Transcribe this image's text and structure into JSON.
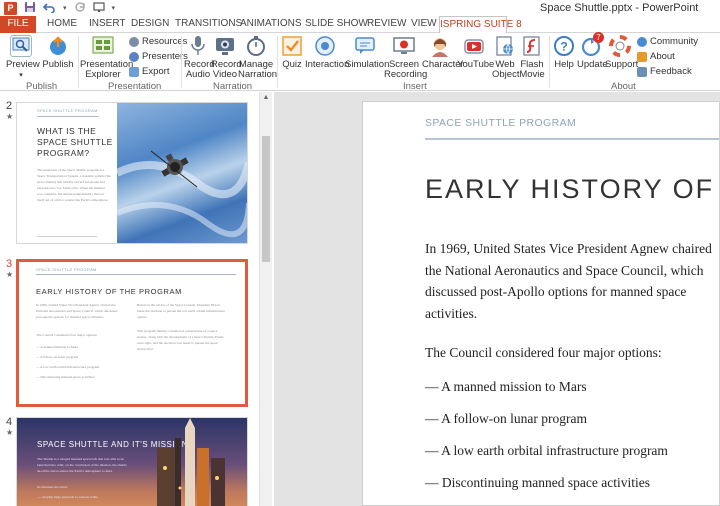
{
  "window": {
    "title": "Space Shuttle.pptx - PowerPoint",
    "app_logo": "P"
  },
  "qat": {
    "save_icon": "save-icon",
    "undo_icon": "undo-icon",
    "redo_icon": "redo-icon"
  },
  "tabs": [
    {
      "label": "FILE"
    },
    {
      "label": "HOME"
    },
    {
      "label": "INSERT"
    },
    {
      "label": "DESIGN"
    },
    {
      "label": "TRANSITIONS"
    },
    {
      "label": "ANIMATIONS"
    },
    {
      "label": "SLIDE SHOW"
    },
    {
      "label": "REVIEW"
    },
    {
      "label": "VIEW"
    },
    {
      "label": "ISPRING SUITE 8"
    }
  ],
  "ribbon": {
    "publish_group": {
      "label": "Publish",
      "preview": "Preview",
      "preview_arrow": "▾",
      "publish": "Publish"
    },
    "presentation_group": {
      "label": "Presentation",
      "explorer_line1": "Presentation",
      "explorer_line2": "Explorer",
      "resources": "Resources",
      "presenters": "Presenters",
      "export": "Export"
    },
    "narration_group": {
      "label": "Narration",
      "record_audio_1": "Record",
      "record_audio_2": "Audio",
      "record_video_1": "Record",
      "record_video_2": "Video",
      "manage_1": "Manage",
      "manage_2": "Narration"
    },
    "insert_group": {
      "label": "Insert",
      "quiz": "Quiz",
      "interaction": "Interaction",
      "simulation": "Simulation",
      "screen_1": "Screen",
      "screen_2": "Recording",
      "character": "Character",
      "youtube": "YouTube",
      "web_1": "Web",
      "web_2": "Object",
      "flash_1": "Flash",
      "flash_2": "Movie"
    },
    "about_group": {
      "label": "About",
      "help": "Help",
      "update": "Update",
      "update_badge": "7",
      "support": "Support",
      "community": "Community",
      "about": "About",
      "feedback": "Feedback"
    }
  },
  "thumbnails": [
    {
      "number": "2",
      "kicker": "SPACE SHUTTLE PROGRAM",
      "title_lines": [
        "WHAT IS THE",
        "SPACE SHUTTLE",
        "PROGRAM?"
      ],
      "body": "The main idea of the Space Shuttle program is a Space Transportation System, a reusable vehicle (the space shuttle) that usually carried astronauts and payloads into low Earth orbit. When the mission was complete, the shuttle independently moved itself out of orbit to reenter the Earth's atmosphere."
    },
    {
      "number": "3",
      "kicker": "SPACE SHUTTLE PROGRAM",
      "title": "EARLY HISTORY OF THE PROGRAM",
      "col1": "In 1969, United States Vice President Agnew chaired the National Aeronautics and Space Council, which discussed post-Apollo options for manned space activities.",
      "col1b": "The Council considered four major options:",
      "bullets": [
        "— A manned mission to Mars",
        "— A follow-on lunar program",
        "— A low earth orbital infrastructure program",
        "— Discontinuing manned space activities"
      ],
      "col2": "Based on the advice of the Space Council, President Nixon made the decision to pursue the low earth orbital infrastructure option.",
      "col2b": "This program mainly consisted of construction of a space station, along with the development of a Space Shuttle. Funds were tight, and the decision was made to pursue the space station first."
    },
    {
      "number": "4",
      "title": "SPACE SHUTTLE AND IT'S MISSIONS",
      "body": "The Shuttle is a winged manned spacecraft that was able to be launched into orbit, on the conclusion of the mission, the shuttle de-orbits and re-enters the Earth's atmosphere to land.",
      "body2": "Its missions involved:",
      "body3": "— carrying large payloads to various orbits"
    }
  ],
  "main_slide": {
    "kicker": "SPACE SHUTTLE PROGRAM",
    "title": "EARLY HISTORY OF THE PROGRAM",
    "para1": "In 1969, United States Vice President Agnew chaired the National Aeronautics and Space Council, which discussed post-Apollo options for manned space activities.",
    "para2": "The Council considered four major options:",
    "bullets": [
      "— A manned mission to Mars",
      "— A follow-on lunar program",
      "— A low earth orbital infrastructure program",
      "— Discontinuing manned space activities"
    ]
  },
  "colors": {
    "file_tab": "#d24726",
    "active_thumb_border": "#e05b3c",
    "ispring_tab_text": "#c43e1c"
  }
}
